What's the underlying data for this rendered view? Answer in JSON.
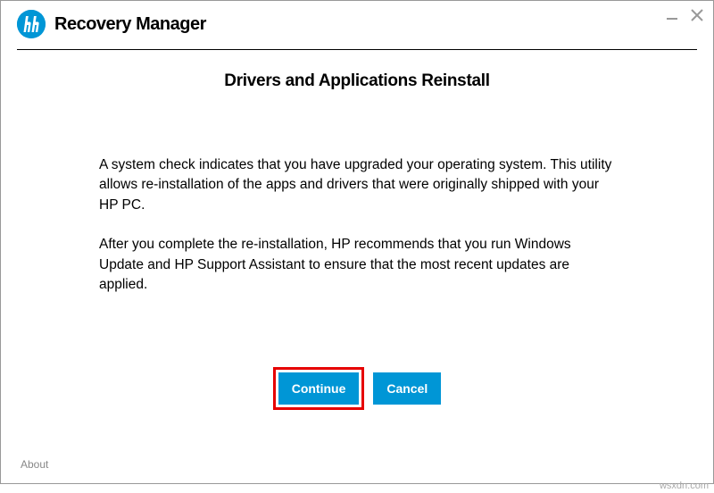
{
  "header": {
    "app_title": "Recovery Manager"
  },
  "page": {
    "heading": "Drivers and Applications Reinstall",
    "paragraph1": "A system check indicates that you have upgraded your operating system. This utility allows re-installation of the apps and drivers that were originally shipped with your HP PC.",
    "paragraph2": "After you complete the re-installation, HP recommends that you run Windows Update and HP Support Assistant to ensure that the most recent updates are applied."
  },
  "buttons": {
    "continue_label": "Continue",
    "cancel_label": "Cancel"
  },
  "footer": {
    "about_label": "About"
  },
  "watermark": "wsxdn.com"
}
